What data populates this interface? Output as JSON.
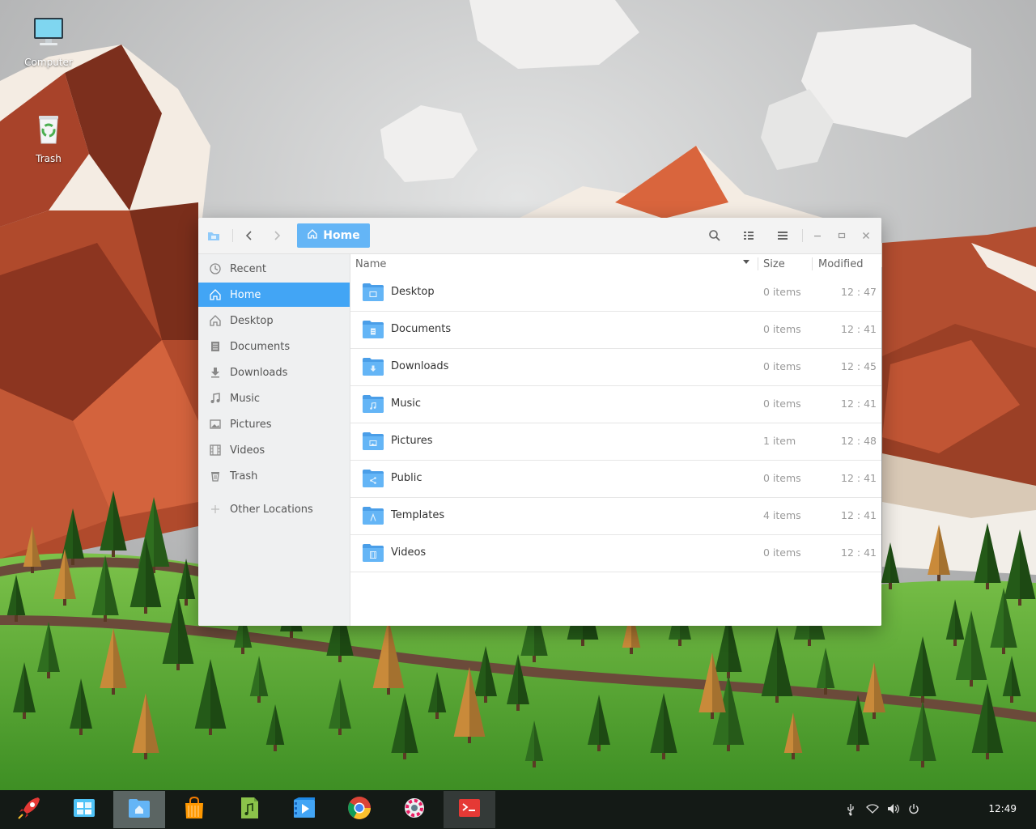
{
  "desktop": {
    "icons": [
      {
        "label": "Computer",
        "icon": "computer-icon"
      },
      {
        "label": "Trash",
        "icon": "trash-icon"
      }
    ]
  },
  "window": {
    "path": {
      "label": "Home"
    },
    "sidebar": {
      "items": [
        {
          "label": "Recent",
          "icon": "clock-icon"
        },
        {
          "label": "Home",
          "icon": "home-icon",
          "active": true
        },
        {
          "label": "Desktop",
          "icon": "desktop-icon"
        },
        {
          "label": "Documents",
          "icon": "document-icon"
        },
        {
          "label": "Downloads",
          "icon": "download-icon"
        },
        {
          "label": "Music",
          "icon": "music-icon"
        },
        {
          "label": "Pictures",
          "icon": "picture-icon"
        },
        {
          "label": "Videos",
          "icon": "video-icon"
        },
        {
          "label": "Trash",
          "icon": "trash-icon"
        },
        {
          "label": "Other Locations",
          "icon": "plus-icon"
        }
      ]
    },
    "columns": {
      "name": "Name",
      "size": "Size",
      "modified": "Modified"
    },
    "files": [
      {
        "name": "Desktop",
        "size": "0 items",
        "modified": "12 : 47",
        "emblem": "desktop"
      },
      {
        "name": "Documents",
        "size": "0 items",
        "modified": "12 : 41",
        "emblem": "document"
      },
      {
        "name": "Downloads",
        "size": "0 items",
        "modified": "12 : 45",
        "emblem": "download"
      },
      {
        "name": "Music",
        "size": "0 items",
        "modified": "12 : 41",
        "emblem": "music"
      },
      {
        "name": "Pictures",
        "size": "1 item",
        "modified": "12 : 48",
        "emblem": "picture"
      },
      {
        "name": "Public",
        "size": "0 items",
        "modified": "12 : 41",
        "emblem": "share"
      },
      {
        "name": "Templates",
        "size": "4 items",
        "modified": "12 : 41",
        "emblem": "template"
      },
      {
        "name": "Videos",
        "size": "0 items",
        "modified": "12 : 41",
        "emblem": "video"
      }
    ]
  },
  "taskbar": {
    "apps": [
      {
        "icon": "rocket-launcher-icon"
      },
      {
        "icon": "app-store-icon"
      },
      {
        "icon": "files-icon",
        "state": "active"
      },
      {
        "icon": "shopping-bag-icon"
      },
      {
        "icon": "music-player-icon"
      },
      {
        "icon": "video-player-icon"
      },
      {
        "icon": "chrome-icon"
      },
      {
        "icon": "settings-icon"
      },
      {
        "icon": "terminal-icon",
        "state": "running"
      }
    ],
    "tray": [
      "usb-icon",
      "wifi-icon",
      "volume-icon",
      "power-icon"
    ],
    "clock": "12:49"
  },
  "colors": {
    "accent": "#42a5f5",
    "folder": "#64b5f6",
    "taskbar": "#141a16"
  }
}
